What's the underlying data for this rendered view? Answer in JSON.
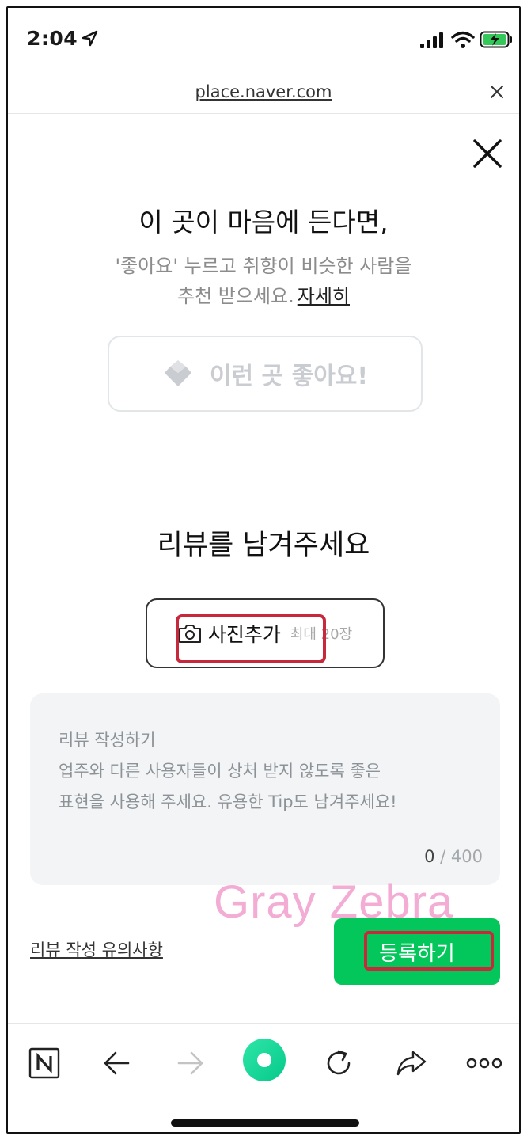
{
  "status_bar": {
    "time": "2:04",
    "icons": [
      "location-arrow-icon",
      "signal-bars-icon",
      "wifi-icon",
      "battery-charging-icon"
    ]
  },
  "browser": {
    "url": "place.naver.com",
    "close_icon": "close-icon"
  },
  "like_section": {
    "title": "이 곳이 마음에 든다면,",
    "description_line1": "'좋아요' 누르고 취향이 비슷한 사람을",
    "description_line2": "추천 받으세요.",
    "more_link": "자세히",
    "like_button_label": "이런 곳 좋아요!",
    "like_icon": "heart-icon"
  },
  "review_section": {
    "title": "리뷰를 남겨주세요",
    "add_photo_label": "사진추가",
    "add_photo_limit": "최대 20장",
    "textarea": {
      "placeholder_line1": "리뷰 작성하기",
      "placeholder_line2": "업주와 다른 사용자들이 상처 받지 않도록 좋은",
      "placeholder_line3": "표현을 사용해 주세요. 유용한 Tip도 남겨주세요!",
      "count_current": "0",
      "count_max": "/ 400"
    },
    "guide_link": "리뷰 작성 유의사항",
    "submit_label": "등록하기"
  },
  "watermark": "Gray Zebra",
  "bottom_toolbar": {
    "items": [
      "naver-home-icon",
      "back-arrow-icon",
      "forward-arrow-icon",
      "green-dot-icon",
      "refresh-icon",
      "share-icon",
      "more-icon"
    ]
  },
  "colors": {
    "accent_green": "#03c75a",
    "highlight_red": "#c8283c",
    "watermark_pink": "#f3a7d2"
  }
}
